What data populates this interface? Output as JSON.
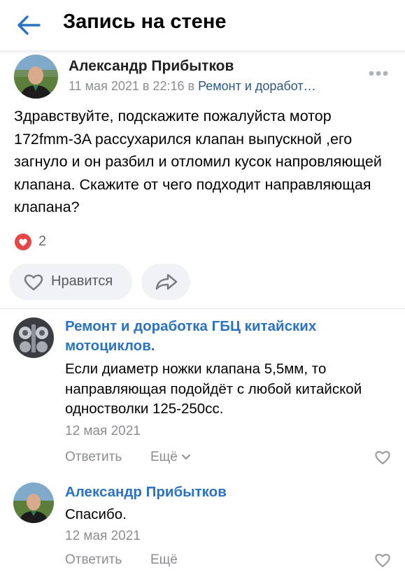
{
  "header": {
    "title": "Запись на стене",
    "back_icon": "arrow-left-icon"
  },
  "post": {
    "author": "Александр Прибытков",
    "date": "11 мая 2021 в 22:16 в",
    "group": "Ремонт и доработ…",
    "text": "Здравствуйте, подскажите пожалуйста мотор 172fmm-3A рассухарился клапан выпускной ,его загнуло и он разбил и отломил кусок напровляющей клапана. Скажите от чего подходит направляющая клапана?",
    "likes": "2",
    "like_button": "Нравится"
  },
  "comments": [
    {
      "author": "Ремонт и доработка ГБЦ китайских мотоциклов.",
      "text": "Если диаметр ножки клапана 5,5мм, то направляющая подойдёт с любой китайской одностволки 125-250сс.",
      "date": "12 мая 2021",
      "reply": "Ответить",
      "more": "Ещё"
    },
    {
      "author": "Александр Прибытков",
      "text": "Спасибо.",
      "date": "12 мая 2021",
      "reply": "Ответить",
      "more": "Ещё"
    }
  ],
  "colors": {
    "accent": "#2a72c2",
    "like_red": "#e64646",
    "secondary_text": "#8a8d91"
  }
}
